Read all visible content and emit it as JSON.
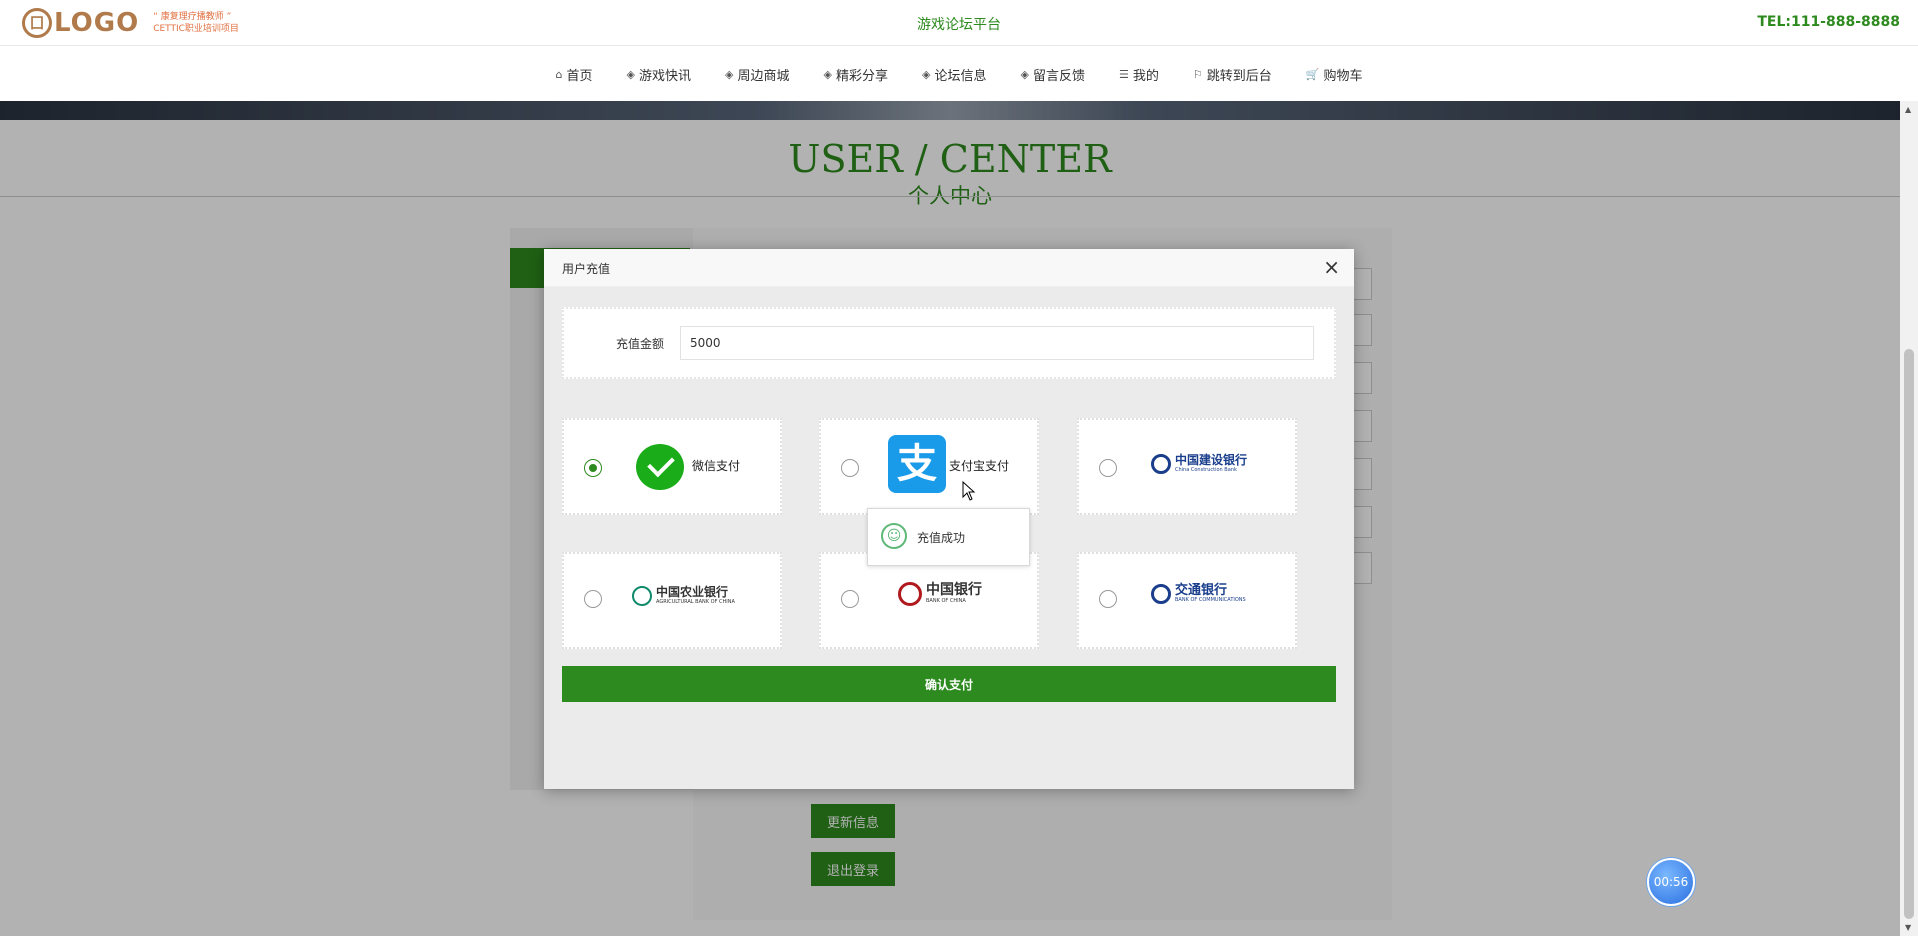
{
  "header": {
    "logo_mark": "囗",
    "logo_text": "LOGO",
    "logo_sub_line1": "“ 康复理疗播教师 ”",
    "logo_sub_line2": "CETTIC职业培训项目",
    "site_title": "游戏论坛平台",
    "tel": "TEL:111-888-8888"
  },
  "nav": {
    "items": [
      {
        "label": "首页",
        "icon": "home-icon"
      },
      {
        "label": "游戏快讯",
        "icon": "layers-icon"
      },
      {
        "label": "周边商城",
        "icon": "layers-icon"
      },
      {
        "label": "精彩分享",
        "icon": "layers-icon"
      },
      {
        "label": "论坛信息",
        "icon": "layers-icon"
      },
      {
        "label": "留言反馈",
        "icon": "layers-icon"
      },
      {
        "label": "我的",
        "icon": "list-icon"
      },
      {
        "label": "跳转到后台",
        "icon": "flag-icon"
      },
      {
        "label": "购物车",
        "icon": "cart-icon"
      }
    ]
  },
  "page": {
    "title_en": "USER / CENTER",
    "title_cn": "个人中心",
    "update_button": "更新信息",
    "logout_button": "退出登录"
  },
  "modal": {
    "title": "用户充值",
    "close": "×",
    "amount_label": "充值金额",
    "amount_value": "5000",
    "options": {
      "wechat": "微信支付",
      "alipay": "支付宝支付",
      "alipay_glyph": "支",
      "ccb_name": "中国建设银行",
      "ccb_en": "China Construction Bank",
      "abc_name": "中国农业银行",
      "abc_en": "AGRICULTURAL BANK OF CHINA",
      "boc_name": "中国银行",
      "boc_en": "BANK OF CHINA",
      "bocom_name": "交通银行",
      "bocom_en": "BANK OF COMMUNICATIONS"
    },
    "selected": "wechat",
    "confirm": "确认支付"
  },
  "toast": {
    "text": "充值成功",
    "icon": "smile-icon"
  },
  "timer": "00:56",
  "colors": {
    "accent": "#2d8a1e",
    "wechat": "#1aad19",
    "alipay": "#1a9bea",
    "ccb": "#1a3e8c",
    "abc": "#0f8a6a",
    "boc": "#b0191e",
    "bocom": "#1a3e8c"
  }
}
